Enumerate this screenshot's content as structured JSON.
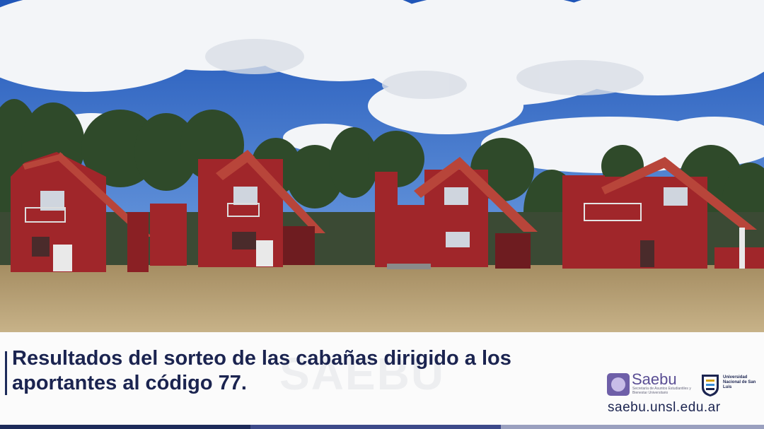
{
  "photo": {
    "subject": "cabins-under-cloudy-sky",
    "colors": {
      "sky": "#2f68c8",
      "cloud": "#f2f4f7",
      "grass": "#b59f73",
      "trees": "#2f4a2a",
      "cabin": "#a0262a",
      "roof": "#b8453a"
    }
  },
  "caption": {
    "headline": "Resultados del sorteo de las cabañas dirigido a los aportantes al código 77.",
    "watermark": "SAEBU",
    "logo_saebu": {
      "name": "Saebu",
      "tagline": "Secretaría de Asuntos Estudiantiles y Bienestar Universitario",
      "color": "#6e5fa8"
    },
    "logo_unsl": {
      "name": "Universidad Nacional de San Luis"
    },
    "url": "saebu.unsl.edu.ar",
    "text_color": "#1b2450"
  },
  "stripe_colors": [
    "#1d2b5a",
    "#3d4a8a",
    "#9aa0bf"
  ]
}
